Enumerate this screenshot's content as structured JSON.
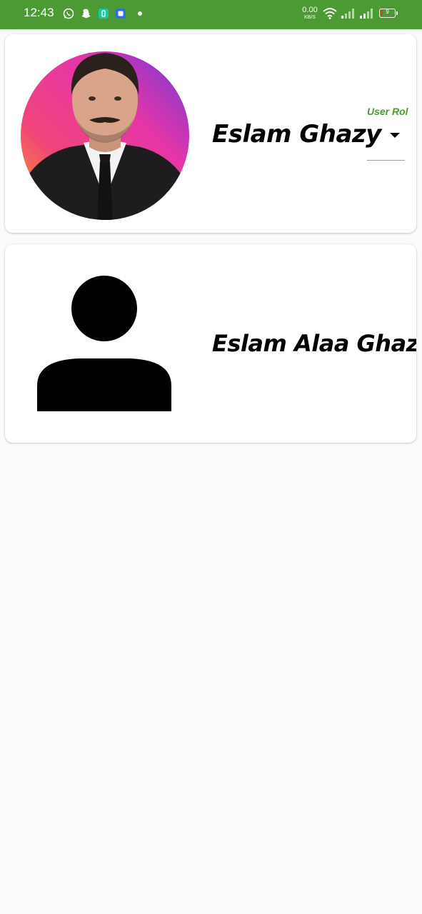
{
  "status_bar": {
    "time": "12:43",
    "speed_value": "0.00",
    "speed_unit": "KB/S",
    "battery_level": "9",
    "icons": [
      "whatsapp-icon",
      "snapchat-icon",
      "battery-saver-icon",
      "app-icon",
      "wifi-icon",
      "signal-icon",
      "signal-icon",
      "battery-icon"
    ]
  },
  "users": [
    {
      "name": "Eslam Ghazy",
      "role_label": "User Rol",
      "avatar": "profile-photo"
    },
    {
      "name": "Eslam Alaa Ghazy",
      "avatar": "person-placeholder-icon"
    }
  ],
  "colors": {
    "status_bar": "#4c9a34",
    "role_label": "#4c9a34",
    "background": "#fbfbfb",
    "card": "#ffffff"
  }
}
